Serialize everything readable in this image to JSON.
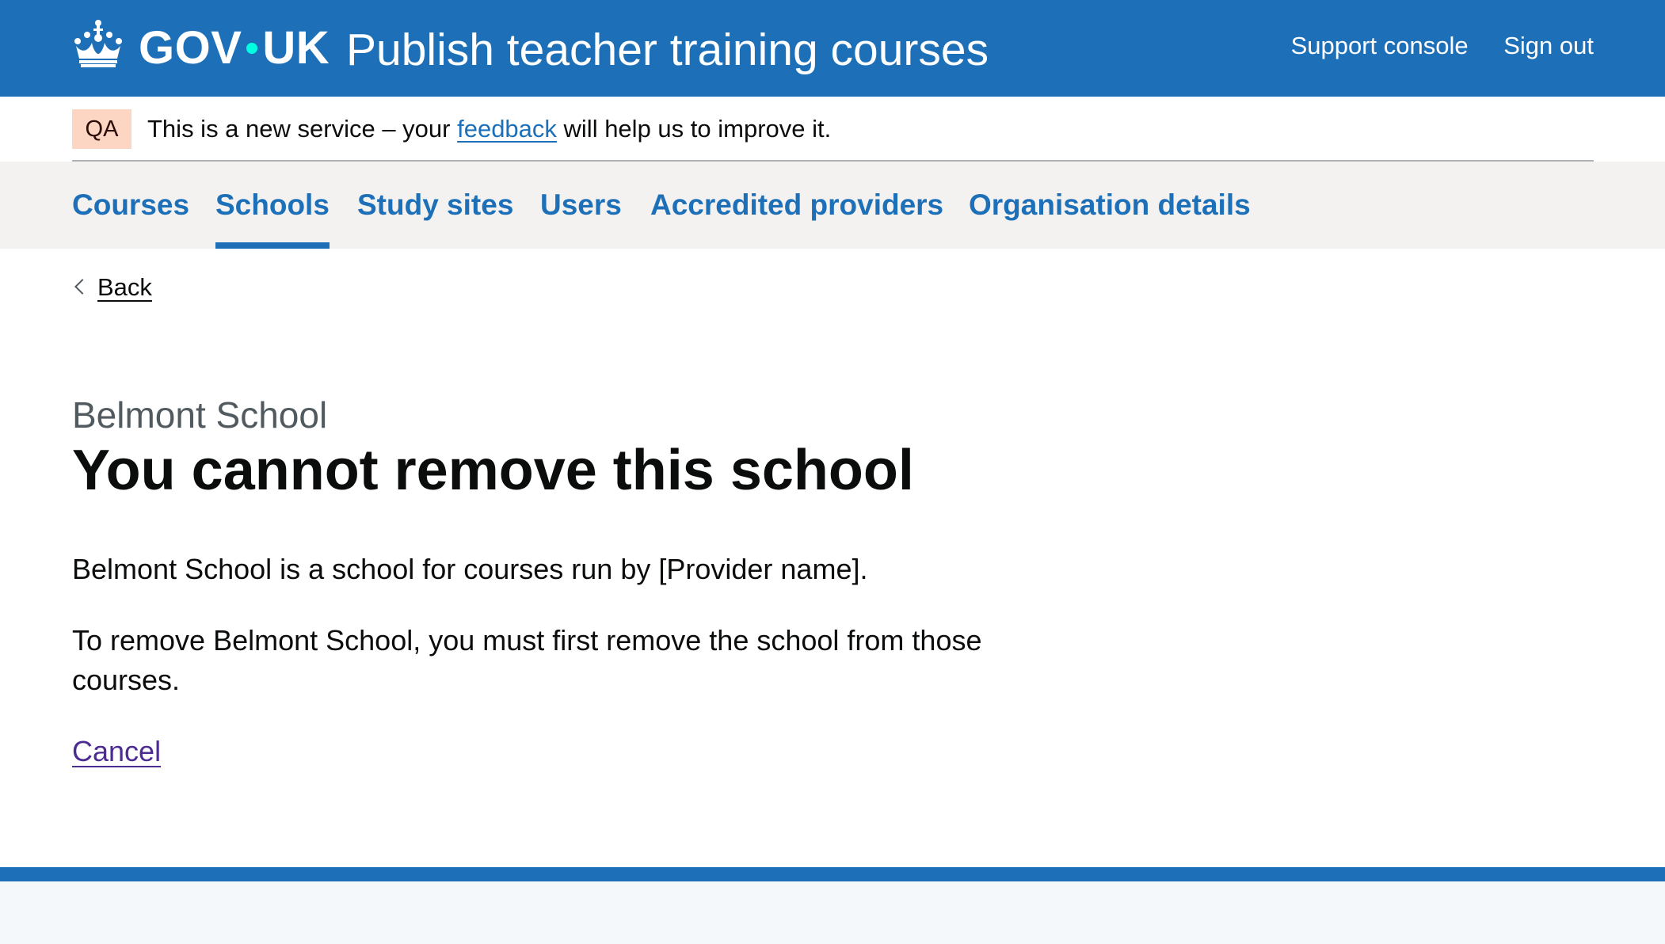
{
  "header": {
    "logotype_left": "GOV",
    "logotype_right": "UK",
    "service_name": "Publish teacher training courses",
    "nav": [
      {
        "label": "Support console"
      },
      {
        "label": "Sign out"
      }
    ]
  },
  "phase_banner": {
    "tag": "QA",
    "text_before": "This is a new service – your ",
    "link": "feedback",
    "text_after": " will help us to improve it."
  },
  "primary_nav": {
    "items": [
      {
        "label": "Courses"
      },
      {
        "label": "Schools"
      },
      {
        "label": "Study sites"
      },
      {
        "label": "Users"
      },
      {
        "label": "Accredited providers"
      },
      {
        "label": "Organisation details"
      }
    ],
    "active": "Schools"
  },
  "back_link": {
    "label": "Back"
  },
  "main": {
    "caption": "Belmont School",
    "heading": "You cannot remove this school",
    "paragraphs": [
      "Belmont School is a school for courses run by [Provider name].",
      "To remove Belmont School, you must first remove the school from those courses."
    ],
    "cancel_label": "Cancel"
  },
  "colors": {
    "header_blue": "#1d70b8",
    "tag_background": "#fcd6c3",
    "nav_background": "#f3f2f1",
    "visited_link": "#4c2c92",
    "footer_background": "#f4f8fb",
    "logo_dot": "#00ffe0"
  },
  "icons": [
    "crown-icon",
    "chevron-left-icon"
  ]
}
